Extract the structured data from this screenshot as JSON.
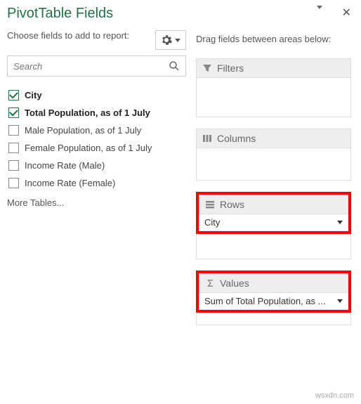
{
  "title": "PivotTable Fields",
  "subhead": "Choose fields to add to report:",
  "search_placeholder": "Search",
  "fields": [
    {
      "label": "City",
      "checked": true
    },
    {
      "label": "Total Population, as of 1 July",
      "checked": true
    },
    {
      "label": "Male Population, as of 1 July",
      "checked": false
    },
    {
      "label": "Female Population, as of 1 July",
      "checked": false
    },
    {
      "label": "Income Rate (Male)",
      "checked": false
    },
    {
      "label": "Income Rate (Female)",
      "checked": false
    }
  ],
  "more_tables": "More Tables...",
  "drag_label": "Drag fields between areas below:",
  "areas": {
    "filters": {
      "label": "Filters",
      "items": []
    },
    "columns": {
      "label": "Columns",
      "items": []
    },
    "rows": {
      "label": "Rows",
      "items": [
        "City"
      ]
    },
    "values": {
      "label": "Values",
      "items": [
        "Sum of Total Population, as ..."
      ]
    }
  },
  "watermark": "wsxdn.com"
}
